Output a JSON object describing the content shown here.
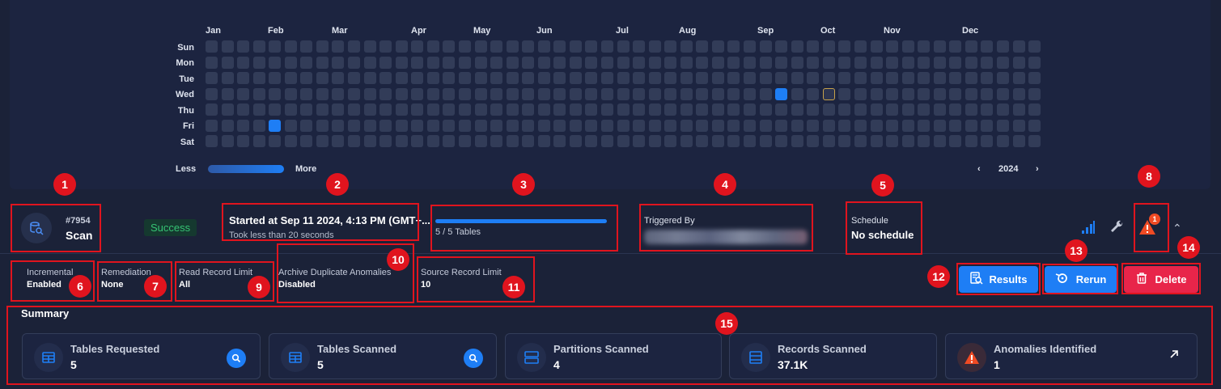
{
  "heatmap": {
    "months": [
      "Jan",
      "Feb",
      "Mar",
      "Apr",
      "May",
      "Jun",
      "Jul",
      "Aug",
      "Sep",
      "Oct",
      "Nov",
      "Dec"
    ],
    "days": [
      "Sun",
      "Mon",
      "Tue",
      "Wed",
      "Thu",
      "Fri",
      "Sat"
    ],
    "legend_less": "Less",
    "legend_more": "More",
    "year": "2024",
    "prev_icon": "chevron-left-icon",
    "next_icon": "chevron-right-icon",
    "cell_color": "#323c58",
    "active_color": "#1e7ef5",
    "active_days": [
      "2024-02-02",
      "2024-09-11"
    ],
    "today": "2024-10-02"
  },
  "job": {
    "id": "#7954",
    "type": "Scan",
    "status": "Success",
    "started": "Started at Sep 11 2024, 4:13 PM (GMT+...",
    "duration": "Took less than 20 seconds",
    "tables_progress": "5 / 5 Tables",
    "progress_fraction": 1.0,
    "triggered_by_label": "Triggered By",
    "schedule_label": "Schedule",
    "schedule_value": "No schedule",
    "warning_count": "1"
  },
  "options": {
    "incremental_label": "Incremental",
    "incremental_value": "Enabled",
    "remediation_label": "Remediation",
    "remediation_value": "None",
    "read_limit_label": "Read Record Limit",
    "read_limit_value": "All",
    "archive_label": "Archive Duplicate Anomalies",
    "archive_value": "Disabled",
    "source_limit_label": "Source Record Limit",
    "source_limit_value": "10"
  },
  "actions": {
    "results": "Results",
    "rerun": "Rerun",
    "delete": "Delete"
  },
  "summary": {
    "title": "Summary",
    "cards": [
      {
        "label": "Tables Requested",
        "value": "5"
      },
      {
        "label": "Tables Scanned",
        "value": "5"
      },
      {
        "label": "Partitions Scanned",
        "value": "4"
      },
      {
        "label": "Records Scanned",
        "value": "37.1K"
      },
      {
        "label": "Anomalies Identified",
        "value": "1"
      }
    ]
  },
  "annotations": [
    "1",
    "2",
    "3",
    "4",
    "5",
    "6",
    "7",
    "8",
    "9",
    "10",
    "11",
    "12",
    "13",
    "14",
    "15"
  ],
  "colors": {
    "accent": "#1e7ef5",
    "success": "#36c474",
    "danger": "#e8254a",
    "warning": "#f04b24",
    "annotation": "#e0141e"
  }
}
